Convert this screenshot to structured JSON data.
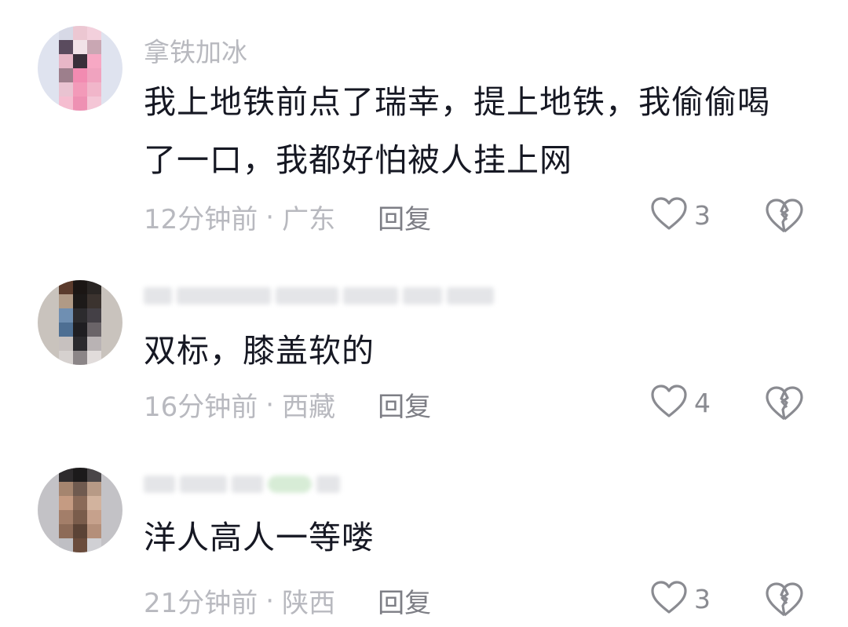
{
  "comments": [
    {
      "username": "拿铁加冰",
      "username_visible": true,
      "text": "我上地铁前点了瑞幸，提上地铁，我偷偷喝了一口，我都好怕被人挂上网",
      "time": "12分钟前",
      "location": "广东",
      "reply_label": "回复",
      "likes": "3",
      "avatar_colors": [
        "#d7d9e6",
        "#ecc7d2",
        "#f3d0dc",
        "#5a4b5e",
        "#f2e3e8",
        "#c9a7b3",
        "#e7b7c7",
        "#392f3a",
        "#f7a8c4",
        "#9d7f8c",
        "#f28bb1",
        "#f0a3bf",
        "#e9c3d1",
        "#f39ab9",
        "#f1b6ca",
        "#f5bdd0",
        "#ee91b3",
        "#f4c6d6"
      ]
    },
    {
      "username": "",
      "username_visible": false,
      "text": "双标，膝盖软的",
      "time": "16分钟前",
      "location": "西藏",
      "reply_label": "回复",
      "likes": "4",
      "avatar_colors": [
        "#5b3b2c",
        "#1b1614",
        "#2a2624",
        "#b09a86",
        "#1d1a19",
        "#3b332f",
        "#6f8fb2",
        "#2c2b2e",
        "#444046",
        "#4e6f93",
        "#1f1e22",
        "#6a6468",
        "#c7c1bf",
        "#2b2a2e",
        "#b9b3b4",
        "#d6d1cf",
        "#8b8587",
        "#e1dcdb"
      ]
    },
    {
      "username": "",
      "username_visible": false,
      "text": "洋人高人一等喽",
      "time": "21分钟前",
      "location": "陕西",
      "reply_label": "回复",
      "likes": "3",
      "avatar_colors": [
        "#2e2b2d",
        "#1c1a1b",
        "#4a4648",
        "#a5856f",
        "#6f5a4f",
        "#b79a86",
        "#c59b82",
        "#8a6a58",
        "#d2b39e",
        "#a37e69",
        "#7a5c4b",
        "#c6a18c",
        "#8d6b58",
        "#5b4336",
        "#b48f7a",
        "#bfbfc4",
        "#6a4c3c",
        "#d0d0d4"
      ]
    }
  ]
}
